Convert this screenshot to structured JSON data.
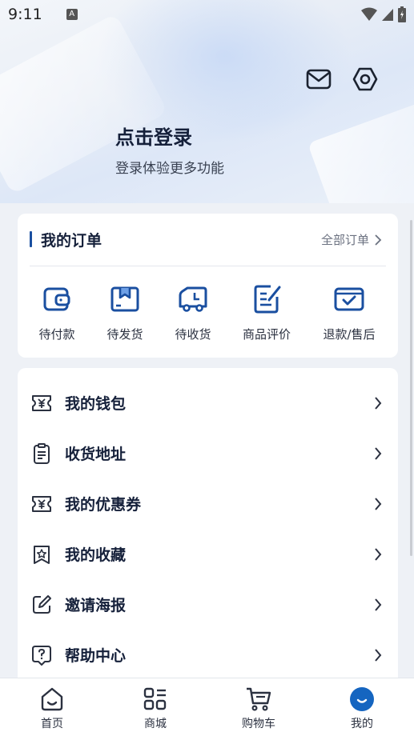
{
  "status_bar": {
    "time": "9:11",
    "notification_icon": "A"
  },
  "header": {
    "login_title": "点击登录",
    "login_subtitle": "登录体验更多功能",
    "icons": [
      "mail-icon",
      "settings-icon"
    ]
  },
  "orders": {
    "title": "我的订单",
    "all_label": "全部订单",
    "items": [
      {
        "label": "待付款",
        "icon": "wallet-icon"
      },
      {
        "label": "待发货",
        "icon": "package-icon"
      },
      {
        "label": "待收货",
        "icon": "truck-icon"
      },
      {
        "label": "商品评价",
        "icon": "review-icon"
      },
      {
        "label": "退款/售后",
        "icon": "refund-icon"
      }
    ]
  },
  "menu": {
    "items": [
      {
        "label": "我的钱包",
        "icon": "yen-ticket-icon"
      },
      {
        "label": "收货地址",
        "icon": "clipboard-icon"
      },
      {
        "label": "我的优惠券",
        "icon": "coupon-icon"
      },
      {
        "label": "我的收藏",
        "icon": "star-bookmark-icon"
      },
      {
        "label": "邀请海报",
        "icon": "edit-icon"
      },
      {
        "label": "帮助中心",
        "icon": "help-icon"
      }
    ]
  },
  "tabbar": {
    "items": [
      {
        "label": "首页",
        "icon": "home-icon",
        "active": false
      },
      {
        "label": "商城",
        "icon": "grid-icon",
        "active": false
      },
      {
        "label": "购物车",
        "icon": "cart-icon",
        "active": false
      },
      {
        "label": "我的",
        "icon": "profile-icon",
        "active": true
      }
    ]
  },
  "colors": {
    "accent": "#1a4fa0",
    "active_tab": "#1565c0",
    "text_dark": "#15203a"
  }
}
